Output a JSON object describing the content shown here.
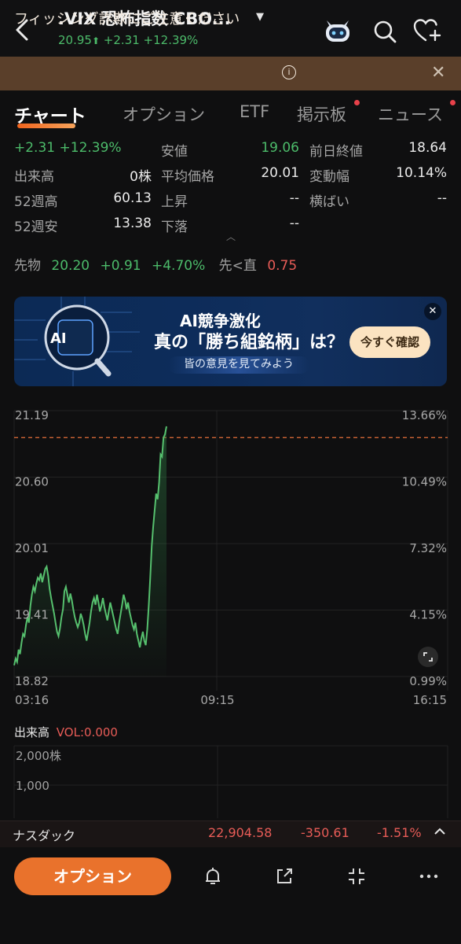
{
  "header": {
    "title": ".VIX 恐怖指数 CBO...",
    "price": "20.95",
    "arrow": "⬆",
    "change": "+2.31",
    "change_pct": "+12.39%",
    "icons": [
      "back-icon",
      "robot-icon",
      "search-icon",
      "heart-add-icon",
      "chevron-down-icon"
    ]
  },
  "banner": {
    "text": "フィッシング詐欺にご注意ください",
    "info": "i",
    "close": "✕"
  },
  "tabs": [
    {
      "label": "チャート",
      "active": true
    },
    {
      "label": "オプション"
    },
    {
      "label": "ETF"
    },
    {
      "label": "掲示板",
      "dot": true
    },
    {
      "label": "ニュース",
      "dot": true
    }
  ],
  "stats": {
    "change": "+2.31",
    "change_pct": "+12.39%",
    "rows": [
      {
        "l1": "出来高",
        "v1": "0株",
        "l2": "平均価格",
        "v2": "20.01",
        "l3": "変動幅",
        "v3": "10.14%"
      },
      {
        "l1": "52週高",
        "v1": "60.13",
        "l2": "上昇",
        "v2": "--",
        "l3": "横ばい",
        "v3": "--"
      },
      {
        "l1": "52週安",
        "v1": "13.38",
        "l2": "下落",
        "v2": "--",
        "l3": "",
        "v3": ""
      }
    ],
    "low_label": "安値",
    "low_value": "19.06",
    "prev_close_label": "前日終値",
    "prev_close_value": "18.64"
  },
  "futures": {
    "label": "先物",
    "price": "20.20",
    "change": "+0.91",
    "pct": "+4.70%",
    "spread_label": "先<直",
    "spread_value": "0.75"
  },
  "ad": {
    "title1": "AI競争激化",
    "title2": "真の「勝ち組銘柄」は？",
    "subtitle": "皆の意見を見てみよう",
    "cta": "今すぐ確認",
    "chip_label": "AI"
  },
  "chart_data": {
    "type": "line",
    "y_left_ticks": [
      "21.19",
      "20.60",
      "20.01",
      "19.41",
      "18.82"
    ],
    "y_right_ticks": [
      "13.66%",
      "10.49%",
      "7.32%",
      "4.15%",
      "0.99%"
    ],
    "x_ticks": [
      "03:16",
      "09:15",
      "16:15"
    ],
    "ylim": [
      18.82,
      21.19
    ],
    "reference_line": 20.95,
    "series": [
      {
        "values": [
          18.92,
          18.98,
          18.95,
          19.06,
          19.02,
          19.12,
          19.2,
          19.18,
          19.28,
          19.35,
          19.3,
          19.45,
          19.55,
          19.62,
          19.58,
          19.65,
          19.7,
          19.68,
          19.74,
          19.66,
          19.72,
          19.78,
          19.8,
          19.72,
          19.6,
          19.52,
          19.45,
          19.38,
          19.3,
          19.22,
          19.18,
          19.25,
          19.35,
          19.42,
          19.58,
          19.62,
          19.55,
          19.48,
          19.56,
          19.5,
          19.42,
          19.35,
          19.3,
          19.26,
          19.3,
          19.38,
          19.34,
          19.28,
          19.2,
          19.14,
          19.22,
          19.3,
          19.4,
          19.48,
          19.52,
          19.46,
          19.55,
          19.48,
          19.4,
          19.45,
          19.52,
          19.44,
          19.38,
          19.32,
          19.4,
          19.48,
          19.42,
          19.36,
          19.3,
          19.24,
          19.2,
          19.3,
          19.38,
          19.46,
          19.55,
          19.5,
          19.42,
          19.48,
          19.4,
          19.34,
          19.28,
          19.24,
          19.3,
          19.2,
          19.14,
          19.08,
          19.16,
          19.22,
          19.14,
          19.1,
          19.24,
          19.45,
          19.7,
          19.98,
          20.15,
          20.3,
          20.45,
          20.4,
          20.55,
          20.8,
          20.78,
          20.95,
          20.98,
          21.05
        ]
      }
    ]
  },
  "volume": {
    "label": "出来高",
    "vol": "VOL:0.000",
    "ticks": [
      "2,000株",
      "1,000"
    ]
  },
  "ticker": {
    "name": "ナスダック",
    "price": "22,904.58",
    "change": "-350.61",
    "pct": "-1.51%"
  },
  "bottom": {
    "option_label": "オプション"
  },
  "colors": {
    "up": "#4cbb6a",
    "down": "#e85c57",
    "accent": "#e9722c",
    "banner": "#5a3f2a"
  }
}
